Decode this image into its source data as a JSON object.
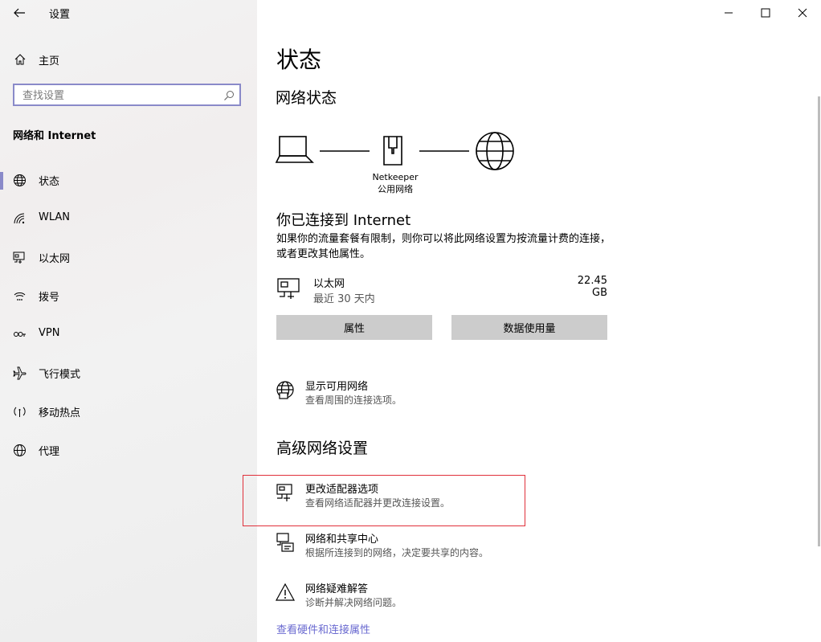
{
  "window": {
    "app_title": "设置"
  },
  "sidebar": {
    "home_label": "主页",
    "search_placeholder": "查找设置",
    "section_title": "网络和 Internet",
    "items": [
      {
        "label": "状态",
        "icon": "globe-icon",
        "active": true
      },
      {
        "label": "WLAN",
        "icon": "wifi-icon"
      },
      {
        "label": "以太网",
        "icon": "ethernet-icon"
      },
      {
        "label": "拨号",
        "icon": "dialup-icon"
      },
      {
        "label": "VPN",
        "icon": "vpn-icon"
      },
      {
        "label": "飞行模式",
        "icon": "airplane-icon"
      },
      {
        "label": "移动热点",
        "icon": "hotspot-icon"
      },
      {
        "label": "代理",
        "icon": "proxy-globe-icon"
      }
    ],
    "accent_color": "#8a8ac9"
  },
  "main": {
    "page_title": "状态",
    "network_status_title": "网络状态",
    "network_name": "Netkeeper",
    "network_type": "公用网络",
    "connected_title": "你已连接到 Internet",
    "connected_desc": "如果你的流量套餐有限制，则你可以将此网络设置为按流量计费的连接，或者更改其他属性。",
    "adapter": {
      "name": "以太网",
      "period": "最近 30 天内",
      "usage": "22.45 GB"
    },
    "buttons": {
      "properties": "属性",
      "data_usage": "数据使用量"
    },
    "show_networks": {
      "title": "显示可用网络",
      "subtitle": "查看周围的连接选项。"
    },
    "advanced_title": "高级网络设置",
    "advanced_options": [
      {
        "title": "更改适配器选项",
        "subtitle": "查看网络适配器并更改连接设置。",
        "icon": "adapter-icon"
      },
      {
        "title": "网络和共享中心",
        "subtitle": "根据所连接到的网络，决定要共享的内容。",
        "icon": "sharing-center-icon"
      },
      {
        "title": "网络疑难解答",
        "subtitle": "诊断并解决网络问题。",
        "icon": "warning-icon"
      }
    ],
    "hardware_link": "查看硬件和连接属性",
    "highlight_color": "#e0303a",
    "link_color": "#6a6ad0"
  }
}
